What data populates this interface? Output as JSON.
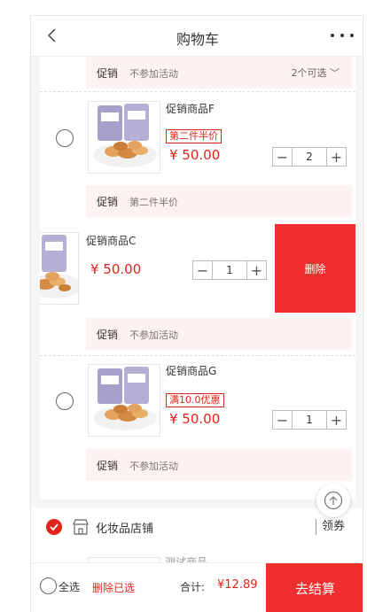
{
  "header": {
    "title": "购物车"
  },
  "promo_bar_top": {
    "tag": "促销",
    "text": "不参加活动",
    "choice": "2个可选"
  },
  "item_f": {
    "name": "促销商品F",
    "badge": "第二件半价",
    "price": "¥ 50.00",
    "qty": "2"
  },
  "promo_bar_f": {
    "tag": "促销",
    "text": "第二件半价"
  },
  "item_c": {
    "name": "促销商品C",
    "price": "¥ 50.00",
    "qty": "1",
    "delete_label": "删除"
  },
  "promo_bar_c": {
    "tag": "促销",
    "text": "不参加活动"
  },
  "item_g": {
    "name": "促销商品G",
    "badge": "满10.0优惠",
    "price": "¥ 50.00",
    "qty": "1"
  },
  "promo_bar_g": {
    "tag": "促销",
    "text": "不参加活动"
  },
  "shop": {
    "name": "化妆品店铺",
    "coupon": "领券",
    "checked": true
  },
  "next_item": {
    "name": "测试商品"
  },
  "footer": {
    "select_all": "全选",
    "delete_selected": "删除已选",
    "total_label": "合计:",
    "total_value": "¥12.89",
    "checkout": "去结算"
  },
  "colors": {
    "accent": "#f02e2e",
    "price": "#e2231a",
    "promo_bg": "#fdf1f1"
  }
}
